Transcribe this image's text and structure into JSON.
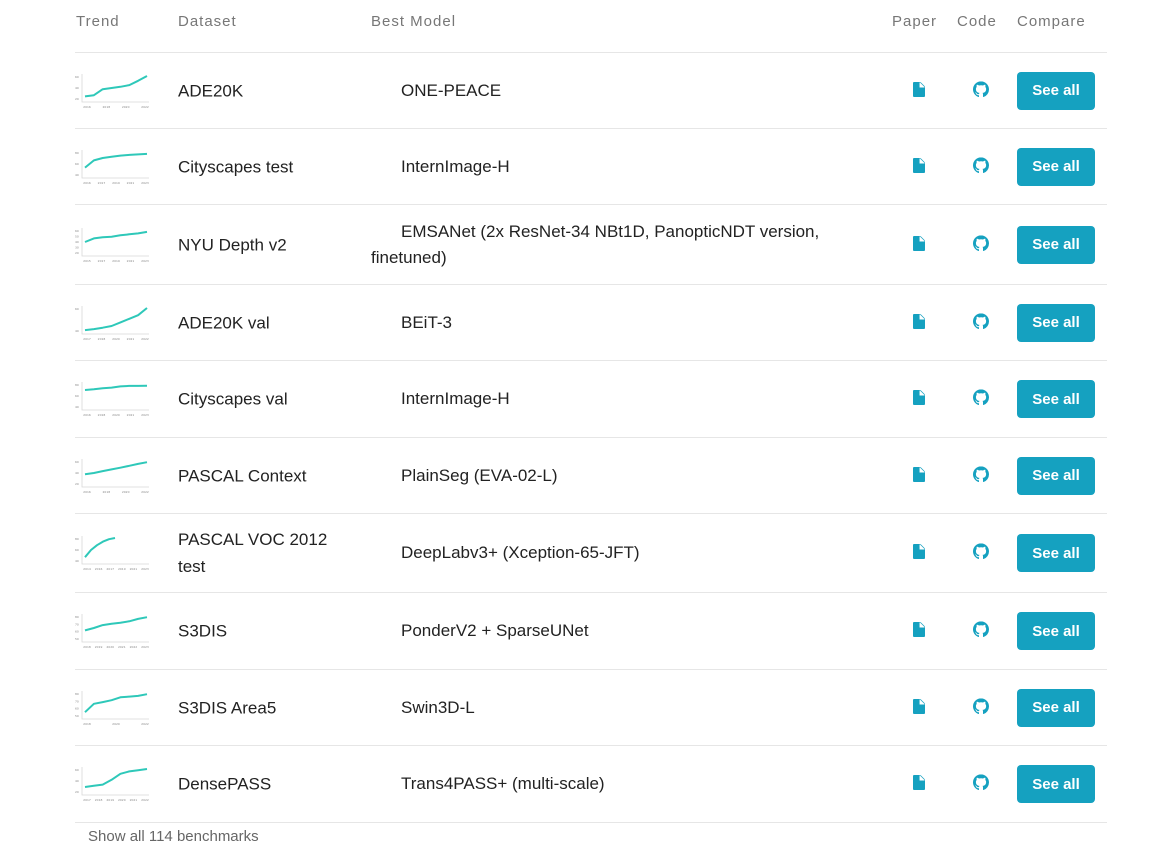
{
  "header": {
    "trend": "Trend",
    "dataset": "Dataset",
    "best_model": "Best Model",
    "paper": "Paper",
    "code": "Code",
    "compare": "Compare"
  },
  "accent_color": "#15a1c0",
  "trend_color": "#2ec8b9",
  "rows": [
    {
      "dataset": "ADE20K",
      "model": "ONE-PEACE",
      "compare": "See all",
      "paper_icon": "paper-icon",
      "code_icon": "github-icon",
      "trend": {
        "x_ticks": [
          "2016",
          "2018",
          "2020",
          "2022"
        ],
        "y_ticks": [
          "60",
          "40",
          "20"
        ],
        "y": [
          0.15,
          0.2,
          0.45,
          0.5,
          0.55,
          0.62,
          0.8,
          1.0
        ]
      }
    },
    {
      "dataset": "Cityscapes test",
      "model": "InternImage-H",
      "compare": "See all",
      "paper_icon": "paper-icon",
      "code_icon": "github-icon",
      "trend": {
        "x_ticks": [
          "2016",
          "2017",
          "2019",
          "2021",
          "2023"
        ],
        "y_ticks": [
          "80",
          "60",
          "40"
        ],
        "y": [
          0.35,
          0.65,
          0.75,
          0.8,
          0.85,
          0.88,
          0.9,
          0.92
        ]
      }
    },
    {
      "dataset": "NYU Depth v2",
      "model": "EMSANet (2x ResNet-34 NBt1D, PanopticNDT version, finetuned)",
      "compare": "See all",
      "paper_icon": "paper-icon",
      "code_icon": "github-icon",
      "trend": {
        "x_ticks": [
          "2015",
          "2017",
          "2019",
          "2021",
          "2023"
        ],
        "y_ticks": [
          "60",
          "50",
          "40",
          "30",
          "20"
        ],
        "y": [
          0.5,
          0.65,
          0.7,
          0.72,
          0.78,
          0.82,
          0.86,
          0.92
        ]
      }
    },
    {
      "dataset": "ADE20K val",
      "model": "BEiT-3",
      "compare": "See all",
      "paper_icon": "paper-icon",
      "code_icon": "github-icon",
      "trend": {
        "x_ticks": [
          "2017",
          "2018",
          "2020",
          "2021",
          "2022"
        ],
        "y_ticks": [
          "60",
          "40"
        ],
        "y": [
          0.08,
          0.12,
          0.18,
          0.25,
          0.4,
          0.55,
          0.7,
          1.0
        ]
      }
    },
    {
      "dataset": "Cityscapes val",
      "model": "InternImage-H",
      "compare": "See all",
      "paper_icon": "paper-icon",
      "code_icon": "github-icon",
      "trend": {
        "x_ticks": [
          "2016",
          "2018",
          "2020",
          "2021",
          "2023"
        ],
        "y_ticks": [
          "80",
          "60",
          "40"
        ],
        "y": [
          0.75,
          0.78,
          0.82,
          0.85,
          0.9,
          0.92,
          0.92,
          0.93
        ]
      }
    },
    {
      "dataset": "PASCAL Context",
      "model": "PlainSeg (EVA-02-L)",
      "compare": "See all",
      "paper_icon": "paper-icon",
      "code_icon": "github-icon",
      "trend": {
        "x_ticks": [
          "2016",
          "2018",
          "2020",
          "2022"
        ],
        "y_ticks": [
          "60",
          "40",
          "20"
        ],
        "y": [
          0.45,
          0.5,
          0.58,
          0.65,
          0.72,
          0.8,
          0.88,
          0.95
        ]
      }
    },
    {
      "dataset": "PASCAL VOC 2012 test",
      "model": "DeepLabv3+ (Xception-65-JFT)",
      "compare": "See all",
      "paper_icon": "paper-icon",
      "code_icon": "github-icon",
      "trend": {
        "x_ticks": [
          "2014",
          "2016",
          "2017",
          "2019",
          "2021",
          "2023"
        ],
        "y_ticks": [
          "80",
          "60",
          "40"
        ],
        "y": [
          0.2,
          0.5,
          0.7,
          0.85,
          0.95,
          1.0
        ]
      }
    },
    {
      "dataset": "S3DIS",
      "model": "PonderV2 + SparseUNet",
      "compare": "See all",
      "paper_icon": "paper-icon",
      "code_icon": "github-icon",
      "trend": {
        "x_ticks": [
          "2018",
          "2019",
          "2020",
          "2021",
          "2022",
          "2023"
        ],
        "y_ticks": [
          "80",
          "70",
          "60",
          "50"
        ],
        "y": [
          0.4,
          0.5,
          0.62,
          0.68,
          0.72,
          0.78,
          0.88,
          0.95
        ]
      }
    },
    {
      "dataset": "S3DIS Area5",
      "model": "Swin3D-L",
      "compare": "See all",
      "paper_icon": "paper-icon",
      "code_icon": "github-icon",
      "trend": {
        "x_ticks": [
          "2018",
          "2020",
          "2022"
        ],
        "y_ticks": [
          "80",
          "70",
          "60",
          "50"
        ],
        "y": [
          0.2,
          0.55,
          0.62,
          0.7,
          0.82,
          0.85,
          0.88,
          0.95
        ]
      }
    },
    {
      "dataset": "DensePASS",
      "model": "Trans4PASS+ (multi-scale)",
      "compare": "See all",
      "paper_icon": "paper-icon",
      "code_icon": "github-icon",
      "trend": {
        "x_ticks": [
          "2017",
          "2018",
          "2019",
          "2020",
          "2021",
          "2022"
        ],
        "y_ticks": [
          "60",
          "40",
          "20"
        ],
        "y": [
          0.25,
          0.3,
          0.35,
          0.55,
          0.8,
          0.9,
          0.95,
          1.0
        ]
      }
    }
  ],
  "footer": {
    "show_all": "Show all 114 benchmarks"
  }
}
